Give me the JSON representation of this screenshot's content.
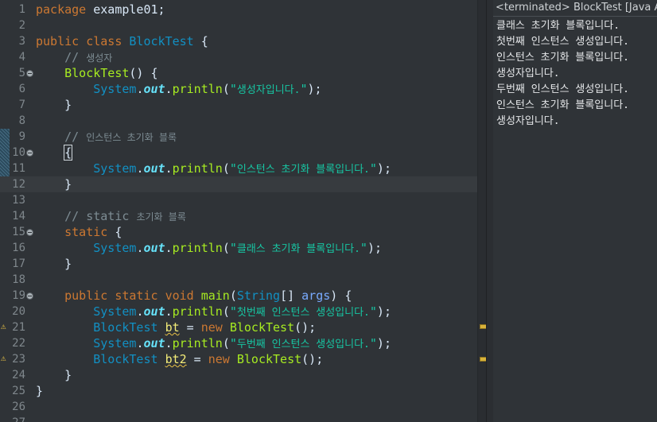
{
  "editor": {
    "lines": [
      {
        "num": "1",
        "tokens": [
          [
            "kw",
            "package"
          ],
          [
            "pl",
            " example01;"
          ]
        ]
      },
      {
        "num": "2",
        "tokens": []
      },
      {
        "num": "3",
        "tokens": [
          [
            "kw",
            "public"
          ],
          [
            "pl",
            " "
          ],
          [
            "kw",
            "class"
          ],
          [
            "pl",
            " "
          ],
          [
            "cls",
            "BlockTest"
          ],
          [
            "pl",
            " {"
          ]
        ]
      },
      {
        "num": "4",
        "tokens": [
          [
            "pl",
            "    "
          ],
          [
            "cmt",
            "// "
          ],
          [
            "cmt cmt-k",
            "생성자"
          ]
        ]
      },
      {
        "num": "5",
        "fold": true,
        "tokens": [
          [
            "pl",
            "    "
          ],
          [
            "mth",
            "BlockTest"
          ],
          [
            "pl",
            "() {"
          ]
        ]
      },
      {
        "num": "6",
        "tokens": [
          [
            "pl",
            "        "
          ],
          [
            "cls",
            "System"
          ],
          [
            "pl",
            "."
          ],
          [
            "fld",
            "out"
          ],
          [
            "pl",
            "."
          ],
          [
            "mth",
            "println"
          ],
          [
            "pl",
            "("
          ],
          [
            "str",
            "\""
          ],
          [
            "str str-k",
            "생성자입니다."
          ],
          [
            "str",
            "\""
          ],
          [
            "pl",
            ");"
          ]
        ]
      },
      {
        "num": "7",
        "tokens": [
          [
            "pl",
            "    }"
          ]
        ]
      },
      {
        "num": "8",
        "tokens": []
      },
      {
        "num": "9",
        "tokens": [
          [
            "pl",
            "    "
          ],
          [
            "cmt",
            "// "
          ],
          [
            "cmt cmt-k",
            "인스턴스 초기화 블록"
          ]
        ]
      },
      {
        "num": "10",
        "fold": true,
        "tokens": [
          [
            "pl",
            "    "
          ],
          [
            "pl brk",
            "{"
          ]
        ]
      },
      {
        "num": "11",
        "tokens": [
          [
            "pl",
            "        "
          ],
          [
            "cls",
            "System"
          ],
          [
            "pl",
            "."
          ],
          [
            "fld",
            "out"
          ],
          [
            "pl",
            "."
          ],
          [
            "mth",
            "println"
          ],
          [
            "pl",
            "("
          ],
          [
            "str",
            "\""
          ],
          [
            "str str-k",
            "인스턴스 초기화 블록입니다."
          ],
          [
            "str",
            "\""
          ],
          [
            "pl",
            ");"
          ]
        ]
      },
      {
        "num": "12",
        "current": true,
        "tokens": [
          [
            "pl",
            "    }"
          ]
        ]
      },
      {
        "num": "13",
        "tokens": []
      },
      {
        "num": "14",
        "tokens": [
          [
            "pl",
            "    "
          ],
          [
            "cmt",
            "// static "
          ],
          [
            "cmt cmt-k",
            "초기화 블록"
          ]
        ]
      },
      {
        "num": "15",
        "fold": true,
        "tokens": [
          [
            "pl",
            "    "
          ],
          [
            "kw",
            "static"
          ],
          [
            "pl",
            " {"
          ]
        ]
      },
      {
        "num": "16",
        "tokens": [
          [
            "pl",
            "        "
          ],
          [
            "cls",
            "System"
          ],
          [
            "pl",
            "."
          ],
          [
            "fld",
            "out"
          ],
          [
            "pl",
            "."
          ],
          [
            "mth",
            "println"
          ],
          [
            "pl",
            "("
          ],
          [
            "str",
            "\""
          ],
          [
            "str str-k",
            "클래스 초기화 블록입니다."
          ],
          [
            "str",
            "\""
          ],
          [
            "pl",
            ");"
          ]
        ]
      },
      {
        "num": "17",
        "tokens": [
          [
            "pl",
            "    }"
          ]
        ]
      },
      {
        "num": "18",
        "tokens": []
      },
      {
        "num": "19",
        "fold": true,
        "tokens": [
          [
            "pl",
            "    "
          ],
          [
            "kw",
            "public"
          ],
          [
            "pl",
            " "
          ],
          [
            "kw",
            "static"
          ],
          [
            "pl",
            " "
          ],
          [
            "kw",
            "void"
          ],
          [
            "pl",
            " "
          ],
          [
            "mth",
            "main"
          ],
          [
            "pl",
            "("
          ],
          [
            "cls",
            "String"
          ],
          [
            "pl",
            "[] "
          ],
          [
            "par",
            "args"
          ],
          [
            "pl",
            ") {"
          ]
        ]
      },
      {
        "num": "20",
        "tokens": [
          [
            "pl",
            "        "
          ],
          [
            "cls",
            "System"
          ],
          [
            "pl",
            "."
          ],
          [
            "fld",
            "out"
          ],
          [
            "pl",
            "."
          ],
          [
            "mth",
            "println"
          ],
          [
            "pl",
            "("
          ],
          [
            "str",
            "\""
          ],
          [
            "str str-k",
            "첫번째 인스턴스 생성입니다."
          ],
          [
            "str",
            "\""
          ],
          [
            "pl",
            ");"
          ]
        ]
      },
      {
        "num": "21",
        "warning": true,
        "tokens": [
          [
            "pl",
            "        "
          ],
          [
            "cls",
            "BlockTest"
          ],
          [
            "pl",
            " "
          ],
          [
            "lv",
            "bt"
          ],
          [
            "pl",
            " = "
          ],
          [
            "kw",
            "new"
          ],
          [
            "pl",
            " "
          ],
          [
            "mth",
            "BlockTest"
          ],
          [
            "pl",
            "();"
          ]
        ]
      },
      {
        "num": "22",
        "tokens": [
          [
            "pl",
            "        "
          ],
          [
            "cls",
            "System"
          ],
          [
            "pl",
            "."
          ],
          [
            "fld",
            "out"
          ],
          [
            "pl",
            "."
          ],
          [
            "mth",
            "println"
          ],
          [
            "pl",
            "("
          ],
          [
            "str",
            "\""
          ],
          [
            "str str-k",
            "두번째 인스턴스 생성입니다."
          ],
          [
            "str",
            "\""
          ],
          [
            "pl",
            ");"
          ]
        ]
      },
      {
        "num": "23",
        "warning": true,
        "tokens": [
          [
            "pl",
            "        "
          ],
          [
            "cls",
            "BlockTest"
          ],
          [
            "pl",
            " "
          ],
          [
            "lv",
            "bt2"
          ],
          [
            "pl",
            " = "
          ],
          [
            "kw",
            "new"
          ],
          [
            "pl",
            " "
          ],
          [
            "mth",
            "BlockTest"
          ],
          [
            "pl",
            "();"
          ]
        ]
      },
      {
        "num": "24",
        "tokens": [
          [
            "pl",
            "    }"
          ]
        ]
      },
      {
        "num": "25",
        "tokens": [
          [
            "pl",
            "}"
          ]
        ]
      },
      {
        "num": "26",
        "tokens": []
      },
      {
        "num": "27",
        "tokens": []
      }
    ]
  },
  "console": {
    "header": "<terminated> BlockTest [Java Application]",
    "output": [
      "클래스 초기화 블록입니다.",
      "첫번째 인스턴스 생성입니다.",
      "인스턴스 초기화 블록입니다.",
      "생성자입니다.",
      "두번째 인스턴스 생성입니다.",
      "인스턴스 초기화 블록입니다.",
      "생성자입니다."
    ]
  },
  "colors": {
    "editor_background": "#2f3337",
    "keyword": "#cc7832",
    "class": "#1290c3",
    "string": "#17c6a3",
    "method": "#a7ec21",
    "comment": "#7d8c93",
    "warning_marker": "#d8b23a"
  },
  "icons": {
    "fold": "fold-collapse-icon",
    "warning": "warning-lightbulb-icon"
  }
}
